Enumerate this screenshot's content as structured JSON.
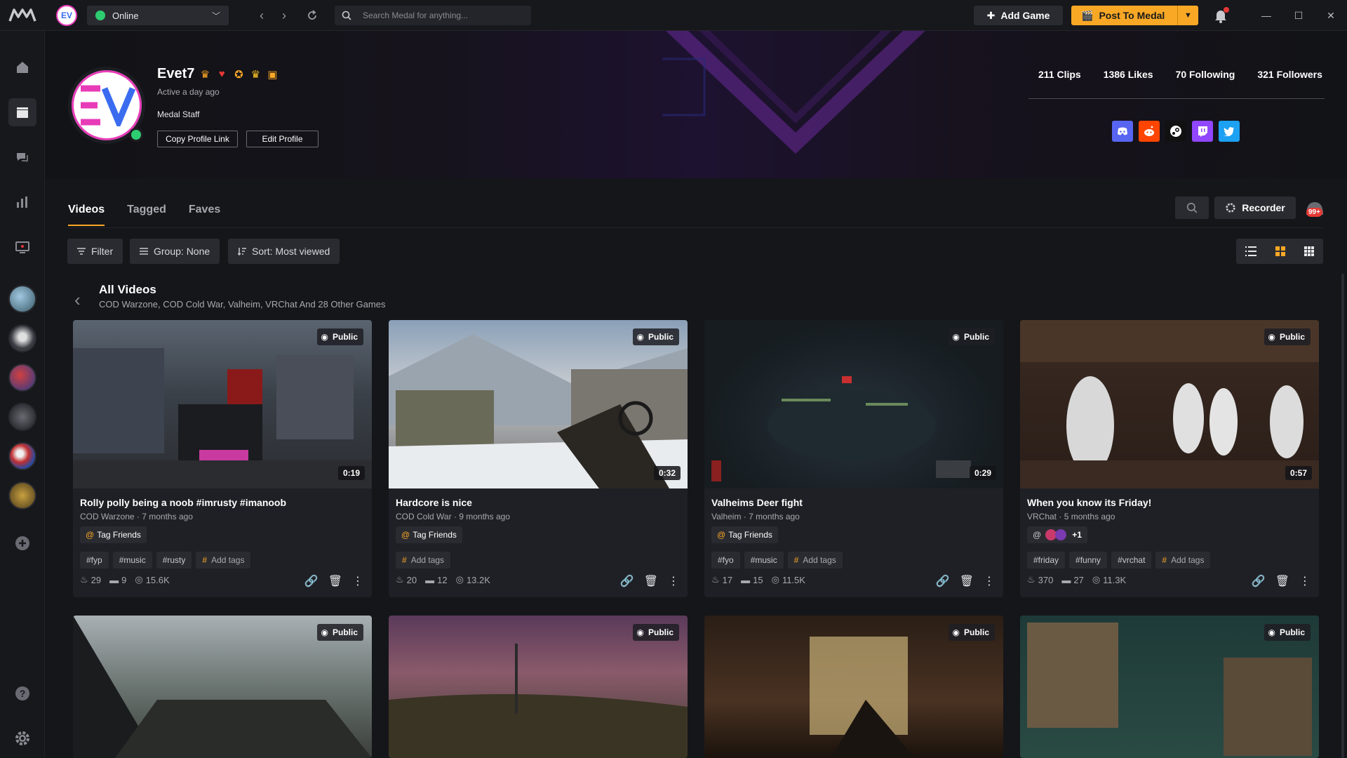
{
  "topbar": {
    "status": "Online",
    "search_placeholder": "Search Medal for anything...",
    "add_game": "Add Game",
    "post": "Post To Medal"
  },
  "profile": {
    "username": "Evet7",
    "active": "Active a day ago",
    "role": "Medal Staff",
    "copy_link": "Copy Profile Link",
    "edit": "Edit Profile",
    "stats": [
      "211 Clips",
      "1386 Likes",
      "70 Following",
      "321 Followers"
    ]
  },
  "tabs": [
    "Videos",
    "Tagged",
    "Faves"
  ],
  "toolbar": {
    "recorder": "Recorder",
    "notif_badge": "99+",
    "filter": "Filter",
    "group": "Group: None",
    "sort": "Sort: Most viewed"
  },
  "group": {
    "title": "All Videos",
    "subtitle": "COD Warzone, COD Cold War, Valheim, VRChat And 28 Other Games"
  },
  "cards": [
    {
      "visibility": "Public",
      "duration": "0:19",
      "title": "Rolly polly being a noob #imrusty #imanoob",
      "game": "COD Warzone",
      "age": "7 months ago",
      "tag_friends": "Tag Friends",
      "tags": [
        "#fyp",
        "#music",
        "#rusty"
      ],
      "add_tags": "Add tags",
      "likes": "29",
      "comments": "9",
      "views": "15.6K"
    },
    {
      "visibility": "Public",
      "duration": "0:32",
      "title": "Hardcore is nice",
      "game": "COD Cold War",
      "age": "9 months ago",
      "tag_friends": "Tag Friends",
      "tags": [],
      "add_tags": "Add tags",
      "likes": "20",
      "comments": "12",
      "views": "13.2K"
    },
    {
      "visibility": "Public",
      "duration": "0:29",
      "title": "Valheims Deer fight",
      "game": "Valheim",
      "age": "7 months ago",
      "tag_friends": "Tag Friends",
      "tags": [
        "#fyo",
        "#music"
      ],
      "add_tags": "Add tags",
      "likes": "17",
      "comments": "15",
      "views": "11.5K"
    },
    {
      "visibility": "Public",
      "duration": "0:57",
      "title": "When you know its Friday!",
      "game": "VRChat",
      "age": "5 months ago",
      "tag_friends": "+1",
      "tags": [
        "#friday",
        "#funny",
        "#vrchat"
      ],
      "add_tags": "Add tags",
      "likes": "370",
      "comments": "27",
      "views": "11.3K"
    }
  ],
  "row2": [
    {
      "visibility": "Public"
    },
    {
      "visibility": "Public"
    },
    {
      "visibility": "Public"
    },
    {
      "visibility": "Public"
    }
  ],
  "colors": {
    "accent": "#f9a825",
    "online": "#2ecc71",
    "brand_pink": "#e83bb8",
    "brand_blue": "#3b6cf0"
  }
}
